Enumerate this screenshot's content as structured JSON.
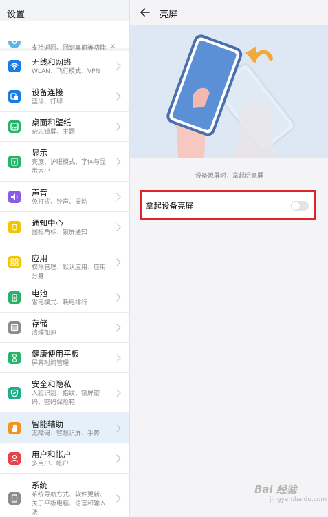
{
  "left": {
    "title": "设置",
    "tip": {
      "text": "支持返回、回到桌面等功能",
      "close": "×"
    },
    "items": [
      {
        "id": "wifi",
        "title": "无线和网络",
        "sub": "WLAN、飞行模式、VPN",
        "icon": "wifi-icon",
        "color": "#1a7de6"
      },
      {
        "id": "device",
        "title": "设备连接",
        "sub": "蓝牙、打印",
        "icon": "device-connect-icon",
        "color": "#1a7de6"
      },
      {
        "id": "desktop",
        "title": "桌面和壁纸",
        "sub": "杂志锁屏、主题",
        "icon": "wallpaper-icon",
        "color": "#27b36a"
      },
      {
        "id": "display",
        "title": "显示",
        "sub": "亮度、护眼模式、字体与显示大小",
        "icon": "display-icon",
        "color": "#27b36a"
      },
      {
        "id": "sound",
        "title": "声音",
        "sub": "免打扰、铃声、振动",
        "icon": "sound-icon",
        "color": "#8a5de6"
      },
      {
        "id": "notify",
        "title": "通知中心",
        "sub": "图标角标、锁屏通知",
        "icon": "bell-icon",
        "color": "#f5c400"
      },
      {
        "id": "apps",
        "title": "应用",
        "sub": "权限管理、默认应用、应用分身",
        "icon": "apps-icon",
        "color": "#f5c400"
      },
      {
        "id": "battery",
        "title": "电池",
        "sub": "省电模式、耗电排行",
        "icon": "battery-icon",
        "color": "#27b36a"
      },
      {
        "id": "storage",
        "title": "存储",
        "sub": "清理加速",
        "icon": "storage-icon",
        "color": "#8c8c8c"
      },
      {
        "id": "health",
        "title": "健康使用平板",
        "sub": "屏幕时间管理",
        "icon": "hourglass-icon",
        "color": "#27b36a"
      },
      {
        "id": "security",
        "title": "安全和隐私",
        "sub": "人脸识别、指纹、锁屏密码、密码保险箱",
        "icon": "shield-icon",
        "color": "#1fae8c"
      },
      {
        "id": "assist",
        "title": "智能辅助",
        "sub": "无障碍、智慧识屏、手势",
        "icon": "hand-icon",
        "color": "#f5931f",
        "selected": true
      },
      {
        "id": "user",
        "title": "用户和帐户",
        "sub": "多用户、帐户",
        "icon": "user-icon",
        "color": "#e8424a"
      },
      {
        "id": "system",
        "title": "系统",
        "sub": "系统导航方式、软件更新、关于平板电脑、语言和输入法",
        "icon": "system-icon",
        "color": "#8c8c8c"
      }
    ]
  },
  "right": {
    "title": "亮屏",
    "caption": "设备熄屏时，拿起后亮屏",
    "toggle": {
      "label": "拿起设备亮屏",
      "on": false
    }
  },
  "watermark": {
    "main": "Bai 经验",
    "sub": "jingyan.baidu.com"
  },
  "colors": {
    "highlight": "#e0242b",
    "selected_row": "#e6f0fb",
    "illustration_bg": "#dde8f4",
    "arrow": "#f2a93b"
  }
}
